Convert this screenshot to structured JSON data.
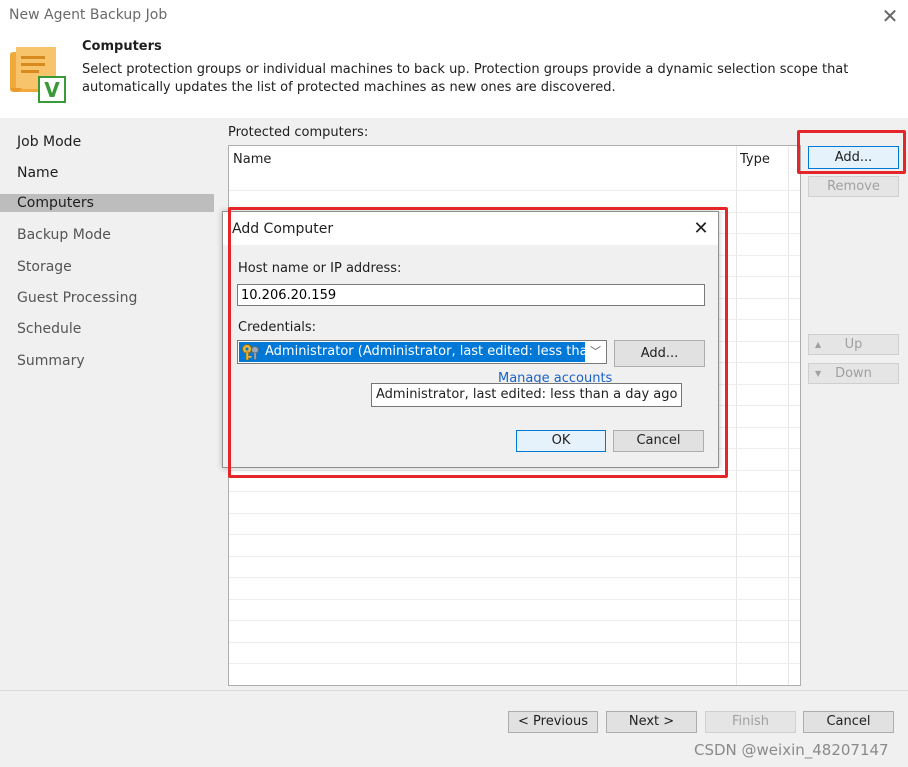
{
  "window": {
    "title": "New Agent Backup Job"
  },
  "header": {
    "title": "Computers",
    "description": "Select protection groups or individual machines to back up. Protection groups provide a dynamic selection scope that automatically updates the list of protected machines as new ones are discovered."
  },
  "nav": {
    "items": [
      {
        "label": "Job Mode",
        "state": "done"
      },
      {
        "label": "Name",
        "state": "done"
      },
      {
        "label": "Computers",
        "state": "active"
      },
      {
        "label": "Backup Mode",
        "state": "todo"
      },
      {
        "label": "Storage",
        "state": "todo"
      },
      {
        "label": "Guest Processing",
        "state": "todo"
      },
      {
        "label": "Schedule",
        "state": "todo"
      },
      {
        "label": "Summary",
        "state": "todo"
      }
    ]
  },
  "main": {
    "protected_label": "Protected computers:",
    "columns": {
      "name": "Name",
      "type": "Type"
    },
    "buttons": {
      "add": "Add...",
      "remove": "Remove",
      "up": "Up",
      "down": "Down"
    }
  },
  "dialog": {
    "title": "Add Computer",
    "host_label": "Host name or IP address:",
    "host_value": "10.206.20.159",
    "credentials_label": "Credentials:",
    "credentials_selected": "Administrator (Administrator, last edited: less than a",
    "add_label": "Add...",
    "manage_accounts": "Manage accounts",
    "tooltip": "Administrator, last edited: less than a day ago",
    "ok": "OK",
    "cancel": "Cancel"
  },
  "footer": {
    "previous": "< Previous",
    "next": "Next >",
    "finish": "Finish",
    "cancel": "Cancel"
  },
  "watermark": "CSDN @weixin_48207147",
  "colors": {
    "highlight": "#e4262a",
    "accent": "#0078d7",
    "link": "#1a62c9"
  }
}
